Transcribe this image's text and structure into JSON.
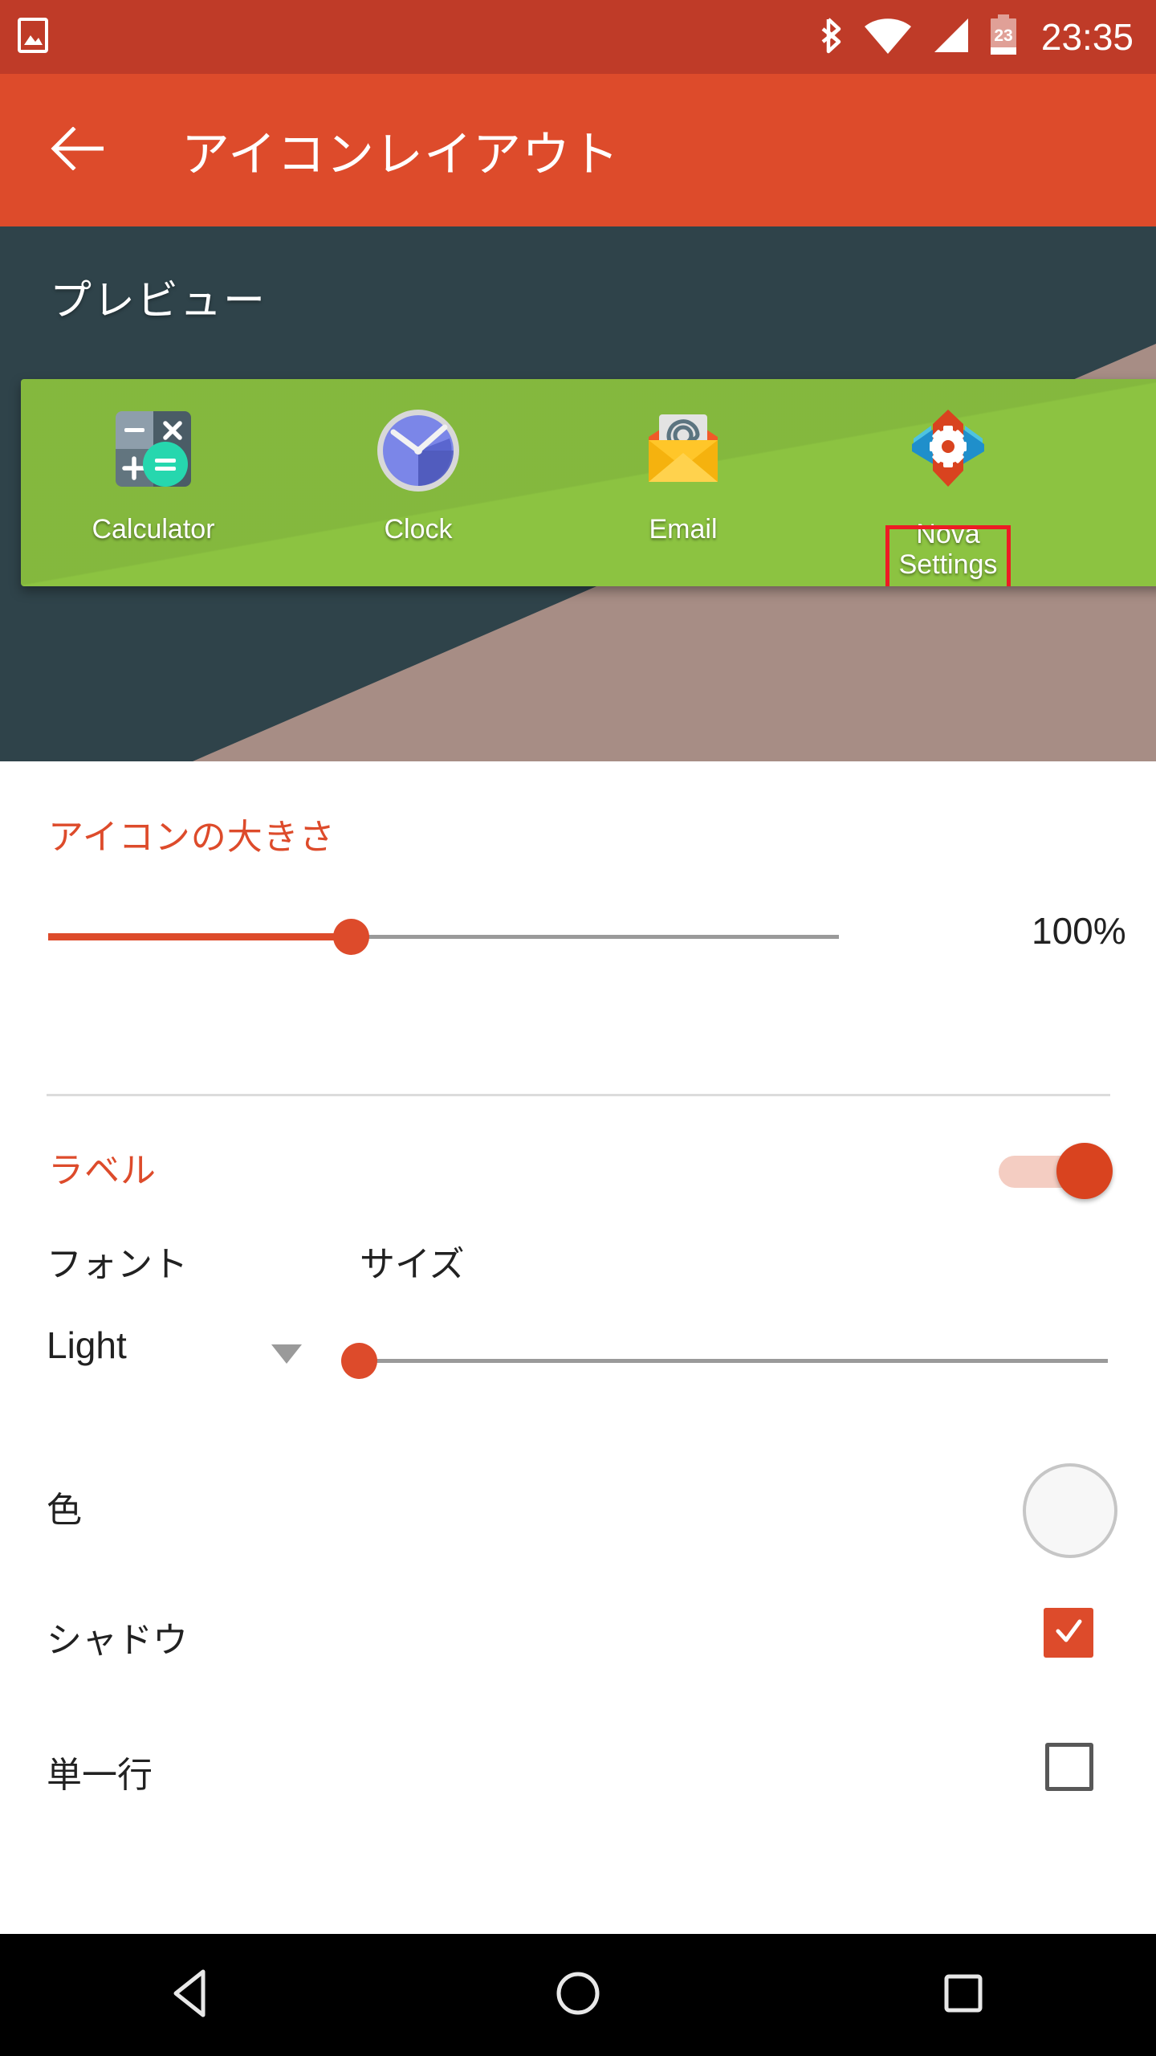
{
  "status_bar": {
    "notification_icon": "image-icon",
    "bluetooth_icon": "bluetooth-icon",
    "wifi_icon": "wifi-icon",
    "signal_icon": "cellular-signal-icon",
    "battery_icon": "battery-icon",
    "battery_level": "23",
    "time": "23:35",
    "background_color": "#bf3b28"
  },
  "app_bar": {
    "back_icon": "back-arrow-icon",
    "title": "アイコンレイアウト",
    "background_color": "#dd4b2b"
  },
  "preview": {
    "heading": "プレビュー",
    "background_color": "#2f434a",
    "wallpaper_color": "#8cc341",
    "selection_color": "#ed1c24",
    "apps": [
      {
        "label": "Calculator",
        "icon": "calculator-icon",
        "selected": false
      },
      {
        "label": "Clock",
        "icon": "clock-icon",
        "selected": false
      },
      {
        "label": "Email",
        "icon": "email-icon",
        "selected": false
      },
      {
        "label": "Nova\nSettings",
        "label_line1": "Nova",
        "label_line2": "Settings",
        "icon": "nova-settings-icon",
        "selected": true
      }
    ]
  },
  "settings": {
    "icon_size": {
      "title": "アイコンの大きさ",
      "value": "100%",
      "slider_percent": 28
    },
    "label": {
      "title": "ラベル",
      "toggle_on": true
    },
    "font_header": "フォント",
    "size_header": "サイズ",
    "font_value": "Light",
    "font_dropdown_icon": "chevron-down-icon",
    "size_slider_percent": 0,
    "color": {
      "label": "色",
      "swatch_color": "#f7f7f7"
    },
    "shadow": {
      "label": "シャドウ",
      "checked": true,
      "checkbox_color": "#dd4b2b"
    },
    "single_line": {
      "label": "単一行",
      "checked": false
    },
    "accent_color": "#dd4b2b"
  },
  "nav_bar": {
    "background_color": "#000000",
    "back_icon": "nav-back-triangle-icon",
    "home_icon": "nav-home-circle-icon",
    "recents_icon": "nav-recents-square-icon"
  }
}
